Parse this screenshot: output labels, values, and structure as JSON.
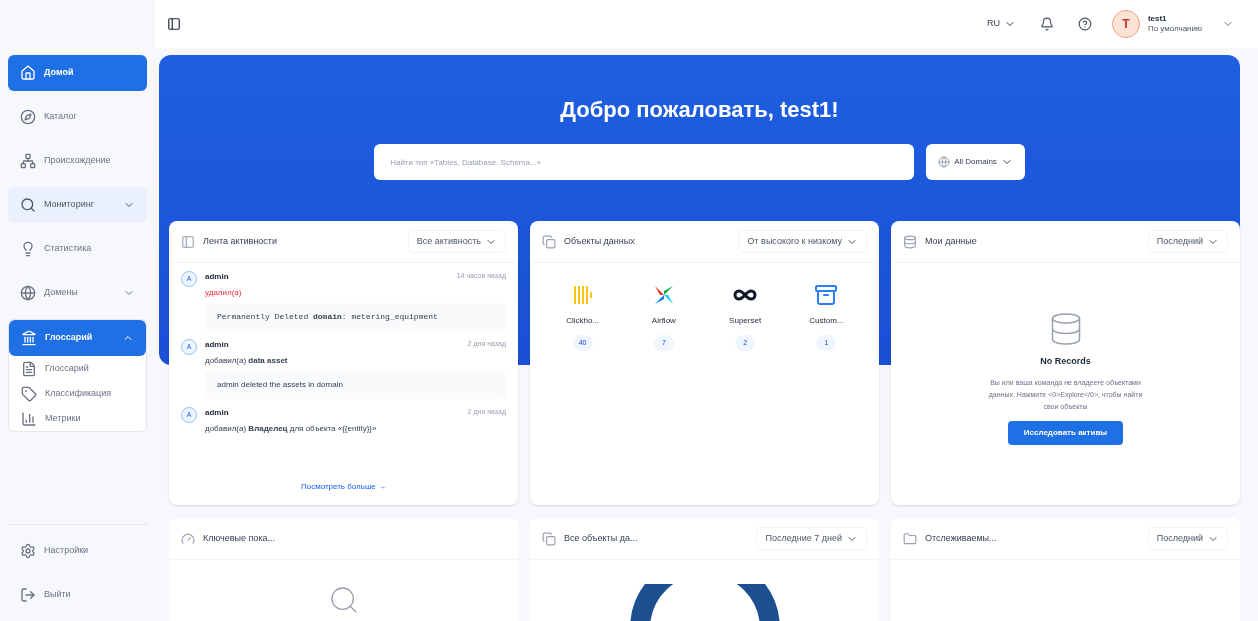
{
  "topbar": {
    "language": "RU",
    "user": {
      "initial": "T",
      "name": "test1",
      "role": "По умолчанию"
    }
  },
  "sidebar": {
    "items": [
      {
        "label": "Домой",
        "selected": true
      },
      {
        "label": "Каталог",
        "selected": false
      },
      {
        "label": "Происхождение",
        "selected": false
      },
      {
        "label": "Мониторинг",
        "selected": false,
        "hovered": true,
        "expanded": false
      },
      {
        "label": "Статистика",
        "selected": false
      },
      {
        "label": "Домены",
        "selected": false,
        "expanded": false
      },
      {
        "label": "Глоссарий",
        "selected": true,
        "expanded": true,
        "children": [
          {
            "label": "Глоссарий"
          },
          {
            "label": "Классификация"
          },
          {
            "label": "Метрики"
          }
        ]
      }
    ],
    "bottom": [
      {
        "label": "Настройки"
      },
      {
        "label": "Выйти"
      }
    ]
  },
  "hero": {
    "title": "Добро пожаловать, test1!",
    "search_placeholder": "Найти тип «Tables, Database, Schema...»",
    "domains": "All Domains"
  },
  "activity": {
    "title": "Лента активности",
    "filter": "Все активность",
    "items": [
      {
        "avatar": "A",
        "user": "admin",
        "time": "14 часов назад",
        "kind": "delete",
        "action": "удалил(а)",
        "detail": "Permanently Deleted **domain**: metering_equipment",
        "detail_code": true
      },
      {
        "avatar": "A",
        "user": "admin",
        "time": "2 дня назад",
        "kind": "add",
        "action": "добавил(а) **data asset**",
        "detail": "admin deleted the assets in domain",
        "detail_code": false
      },
      {
        "avatar": "A",
        "user": "admin",
        "time": "2 дня назад",
        "kind": "add",
        "action": "добавил(а) **Владелец** для объекта «{{entity}}»"
      }
    ],
    "more": "Посмотреть больше →"
  },
  "assets": {
    "title": "Объекты данных",
    "sort": "От высокого к низкому",
    "items": [
      {
        "name": "Clickho...",
        "count": "40"
      },
      {
        "name": "Airflow",
        "count": "7"
      },
      {
        "name": "Superset",
        "count": "2"
      },
      {
        "name": "Custom...",
        "count": "1"
      }
    ]
  },
  "my_data": {
    "title": "Мои данные",
    "filter": "Последний",
    "empty_title": "No Records",
    "empty_text": "Вы или ваша команда не владеете объектами данных. Нажмите <0>Explore</0>, чтобы найти свои объекты",
    "button": "Исследовать активы"
  },
  "bottom_cards": [
    {
      "title": "Ключевые пока...",
      "kind": "empty"
    },
    {
      "title": "Все объекты да...",
      "filter": "Последние 7 дней",
      "kind": "donut"
    },
    {
      "title": "Отслеживаемы...",
      "filter": "Последний",
      "kind": "blank"
    }
  ]
}
